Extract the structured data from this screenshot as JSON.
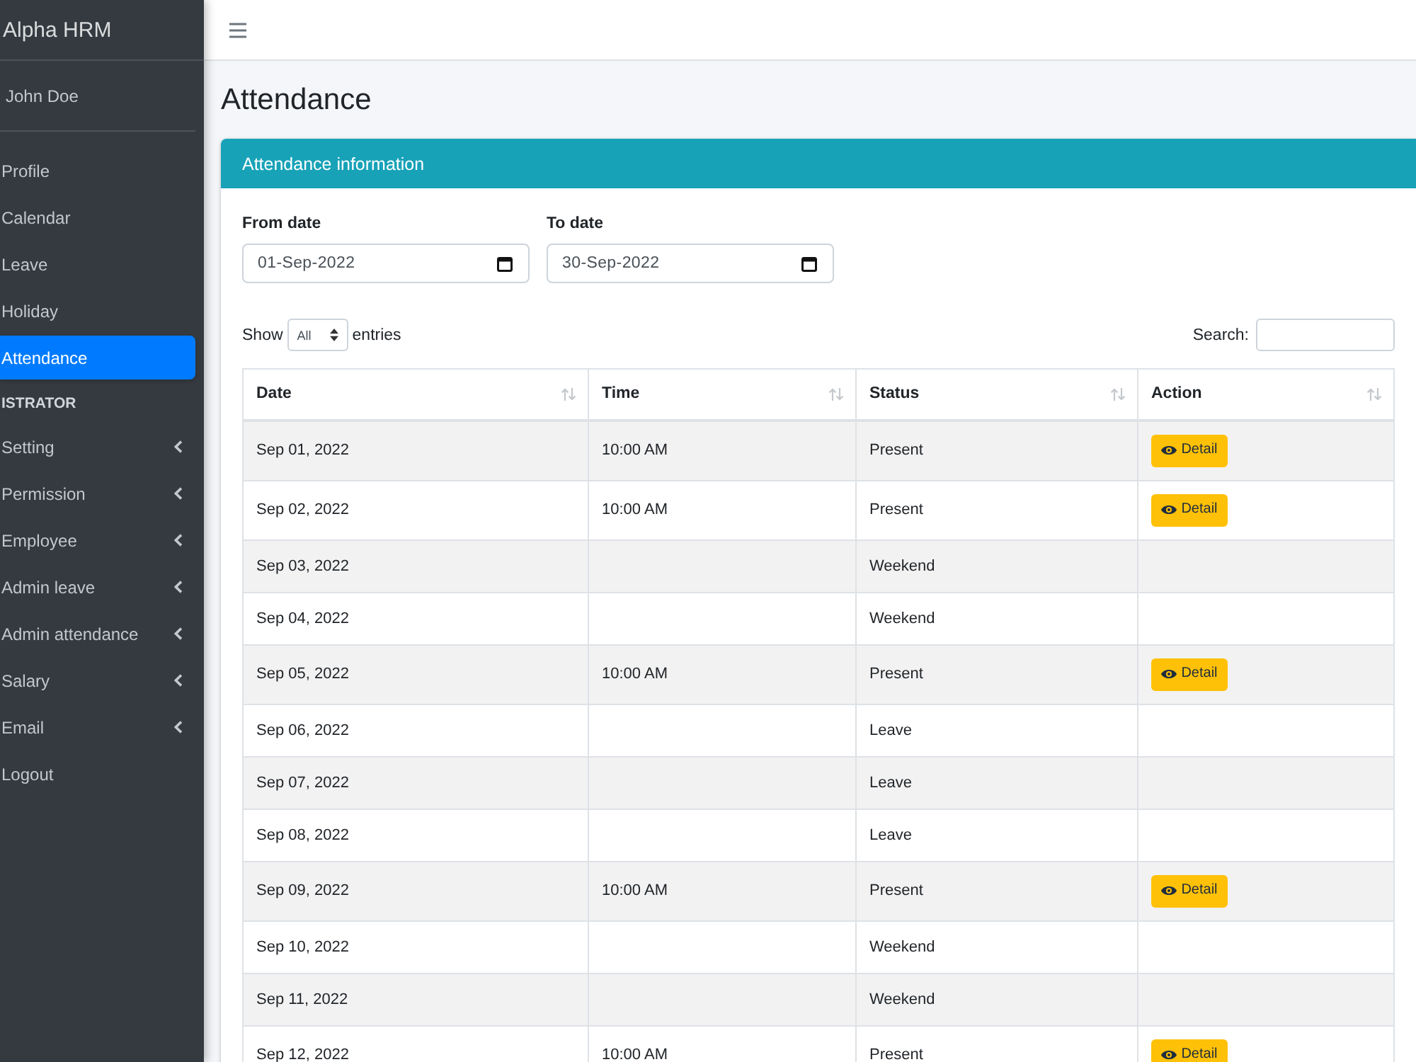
{
  "brand": {
    "name": "Alpha HRM"
  },
  "user": {
    "name": "John Doe"
  },
  "sidebar": {
    "items": [
      {
        "kind": "link",
        "label": "Profile",
        "selected": false
      },
      {
        "kind": "link",
        "label": "Calendar",
        "selected": false
      },
      {
        "kind": "link",
        "label": "Leave",
        "selected": false
      },
      {
        "kind": "link",
        "label": "Holiday",
        "selected": false
      },
      {
        "kind": "link",
        "label": "Attendance",
        "selected": true
      },
      {
        "kind": "header",
        "label": "ISTRATOR"
      },
      {
        "kind": "tree",
        "label": "Setting",
        "selected": false,
        "expanded": false
      },
      {
        "kind": "tree",
        "label": "Permission",
        "selected": false,
        "expanded": false
      },
      {
        "kind": "tree",
        "label": "Employee",
        "selected": false,
        "expanded": false
      },
      {
        "kind": "tree",
        "label": "Admin leave",
        "selected": false,
        "expanded": false
      },
      {
        "kind": "tree",
        "label": "Admin attendance",
        "selected": false,
        "expanded": false
      },
      {
        "kind": "tree",
        "label": "Salary",
        "selected": false,
        "expanded": false
      },
      {
        "kind": "tree",
        "label": "Email",
        "selected": false,
        "expanded": false
      },
      {
        "kind": "link",
        "label": "Logout",
        "selected": false
      }
    ]
  },
  "page": {
    "title": "Attendance"
  },
  "card": {
    "title": "Attendance information",
    "filters": [
      {
        "label": "From date",
        "value": "01-Sep-2022"
      },
      {
        "label": "To date",
        "value": "30-Sep-2022"
      }
    ],
    "length": {
      "prefix": "Show",
      "value": "All",
      "suffix": "entries"
    },
    "search": {
      "label": "Search:"
    },
    "table": {
      "columns": [
        "Date",
        "Time",
        "Status",
        "Action"
      ],
      "rows": [
        {
          "date": "Sep 01, 2022",
          "time": "10:00 AM",
          "status": "Present",
          "action": "Detail"
        },
        {
          "date": "Sep 02, 2022",
          "time": "10:00 AM",
          "status": "Present",
          "action": "Detail"
        },
        {
          "date": "Sep 03, 2022",
          "status": "Weekend"
        },
        {
          "date": "Sep 04, 2022",
          "status": "Weekend"
        },
        {
          "date": "Sep 05, 2022",
          "time": "10:00 AM",
          "status": "Present",
          "action": "Detail"
        },
        {
          "date": "Sep 06, 2022",
          "status": "Leave"
        },
        {
          "date": "Sep 07, 2022",
          "status": "Leave"
        },
        {
          "date": "Sep 08, 2022",
          "status": "Leave"
        },
        {
          "date": "Sep 09, 2022",
          "time": "10:00 AM",
          "status": "Present",
          "action": "Detail"
        },
        {
          "date": "Sep 10, 2022",
          "status": "Weekend"
        },
        {
          "date": "Sep 11, 2022",
          "status": "Weekend"
        },
        {
          "date": "Sep 12, 2022",
          "time": "10:00 AM",
          "status": "Present",
          "action": "Detail"
        }
      ]
    }
  }
}
